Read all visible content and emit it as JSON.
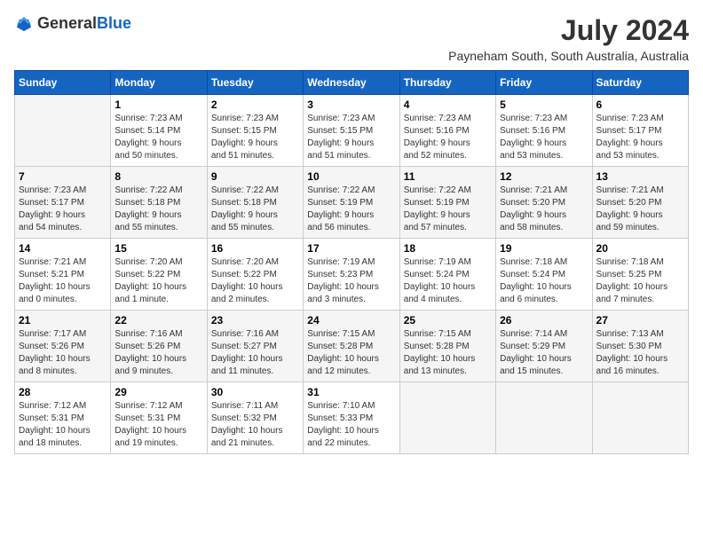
{
  "header": {
    "logo_general": "General",
    "logo_blue": "Blue",
    "title": "July 2024",
    "location": "Payneham South, South Australia, Australia"
  },
  "calendar": {
    "days_of_week": [
      "Sunday",
      "Monday",
      "Tuesday",
      "Wednesday",
      "Thursday",
      "Friday",
      "Saturday"
    ],
    "weeks": [
      [
        {
          "day": "",
          "info": ""
        },
        {
          "day": "1",
          "info": "Sunrise: 7:23 AM\nSunset: 5:14 PM\nDaylight: 9 hours\nand 50 minutes."
        },
        {
          "day": "2",
          "info": "Sunrise: 7:23 AM\nSunset: 5:15 PM\nDaylight: 9 hours\nand 51 minutes."
        },
        {
          "day": "3",
          "info": "Sunrise: 7:23 AM\nSunset: 5:15 PM\nDaylight: 9 hours\nand 51 minutes."
        },
        {
          "day": "4",
          "info": "Sunrise: 7:23 AM\nSunset: 5:16 PM\nDaylight: 9 hours\nand 52 minutes."
        },
        {
          "day": "5",
          "info": "Sunrise: 7:23 AM\nSunset: 5:16 PM\nDaylight: 9 hours\nand 53 minutes."
        },
        {
          "day": "6",
          "info": "Sunrise: 7:23 AM\nSunset: 5:17 PM\nDaylight: 9 hours\nand 53 minutes."
        }
      ],
      [
        {
          "day": "7",
          "info": "Sunrise: 7:23 AM\nSunset: 5:17 PM\nDaylight: 9 hours\nand 54 minutes."
        },
        {
          "day": "8",
          "info": "Sunrise: 7:22 AM\nSunset: 5:18 PM\nDaylight: 9 hours\nand 55 minutes."
        },
        {
          "day": "9",
          "info": "Sunrise: 7:22 AM\nSunset: 5:18 PM\nDaylight: 9 hours\nand 55 minutes."
        },
        {
          "day": "10",
          "info": "Sunrise: 7:22 AM\nSunset: 5:19 PM\nDaylight: 9 hours\nand 56 minutes."
        },
        {
          "day": "11",
          "info": "Sunrise: 7:22 AM\nSunset: 5:19 PM\nDaylight: 9 hours\nand 57 minutes."
        },
        {
          "day": "12",
          "info": "Sunrise: 7:21 AM\nSunset: 5:20 PM\nDaylight: 9 hours\nand 58 minutes."
        },
        {
          "day": "13",
          "info": "Sunrise: 7:21 AM\nSunset: 5:20 PM\nDaylight: 9 hours\nand 59 minutes."
        }
      ],
      [
        {
          "day": "14",
          "info": "Sunrise: 7:21 AM\nSunset: 5:21 PM\nDaylight: 10 hours\nand 0 minutes."
        },
        {
          "day": "15",
          "info": "Sunrise: 7:20 AM\nSunset: 5:22 PM\nDaylight: 10 hours\nand 1 minute."
        },
        {
          "day": "16",
          "info": "Sunrise: 7:20 AM\nSunset: 5:22 PM\nDaylight: 10 hours\nand 2 minutes."
        },
        {
          "day": "17",
          "info": "Sunrise: 7:19 AM\nSunset: 5:23 PM\nDaylight: 10 hours\nand 3 minutes."
        },
        {
          "day": "18",
          "info": "Sunrise: 7:19 AM\nSunset: 5:24 PM\nDaylight: 10 hours\nand 4 minutes."
        },
        {
          "day": "19",
          "info": "Sunrise: 7:18 AM\nSunset: 5:24 PM\nDaylight: 10 hours\nand 6 minutes."
        },
        {
          "day": "20",
          "info": "Sunrise: 7:18 AM\nSunset: 5:25 PM\nDaylight: 10 hours\nand 7 minutes."
        }
      ],
      [
        {
          "day": "21",
          "info": "Sunrise: 7:17 AM\nSunset: 5:26 PM\nDaylight: 10 hours\nand 8 minutes."
        },
        {
          "day": "22",
          "info": "Sunrise: 7:16 AM\nSunset: 5:26 PM\nDaylight: 10 hours\nand 9 minutes."
        },
        {
          "day": "23",
          "info": "Sunrise: 7:16 AM\nSunset: 5:27 PM\nDaylight: 10 hours\nand 11 minutes."
        },
        {
          "day": "24",
          "info": "Sunrise: 7:15 AM\nSunset: 5:28 PM\nDaylight: 10 hours\nand 12 minutes."
        },
        {
          "day": "25",
          "info": "Sunrise: 7:15 AM\nSunset: 5:28 PM\nDaylight: 10 hours\nand 13 minutes."
        },
        {
          "day": "26",
          "info": "Sunrise: 7:14 AM\nSunset: 5:29 PM\nDaylight: 10 hours\nand 15 minutes."
        },
        {
          "day": "27",
          "info": "Sunrise: 7:13 AM\nSunset: 5:30 PM\nDaylight: 10 hours\nand 16 minutes."
        }
      ],
      [
        {
          "day": "28",
          "info": "Sunrise: 7:12 AM\nSunset: 5:31 PM\nDaylight: 10 hours\nand 18 minutes."
        },
        {
          "day": "29",
          "info": "Sunrise: 7:12 AM\nSunset: 5:31 PM\nDaylight: 10 hours\nand 19 minutes."
        },
        {
          "day": "30",
          "info": "Sunrise: 7:11 AM\nSunset: 5:32 PM\nDaylight: 10 hours\nand 21 minutes."
        },
        {
          "day": "31",
          "info": "Sunrise: 7:10 AM\nSunset: 5:33 PM\nDaylight: 10 hours\nand 22 minutes."
        },
        {
          "day": "",
          "info": ""
        },
        {
          "day": "",
          "info": ""
        },
        {
          "day": "",
          "info": ""
        }
      ]
    ]
  }
}
